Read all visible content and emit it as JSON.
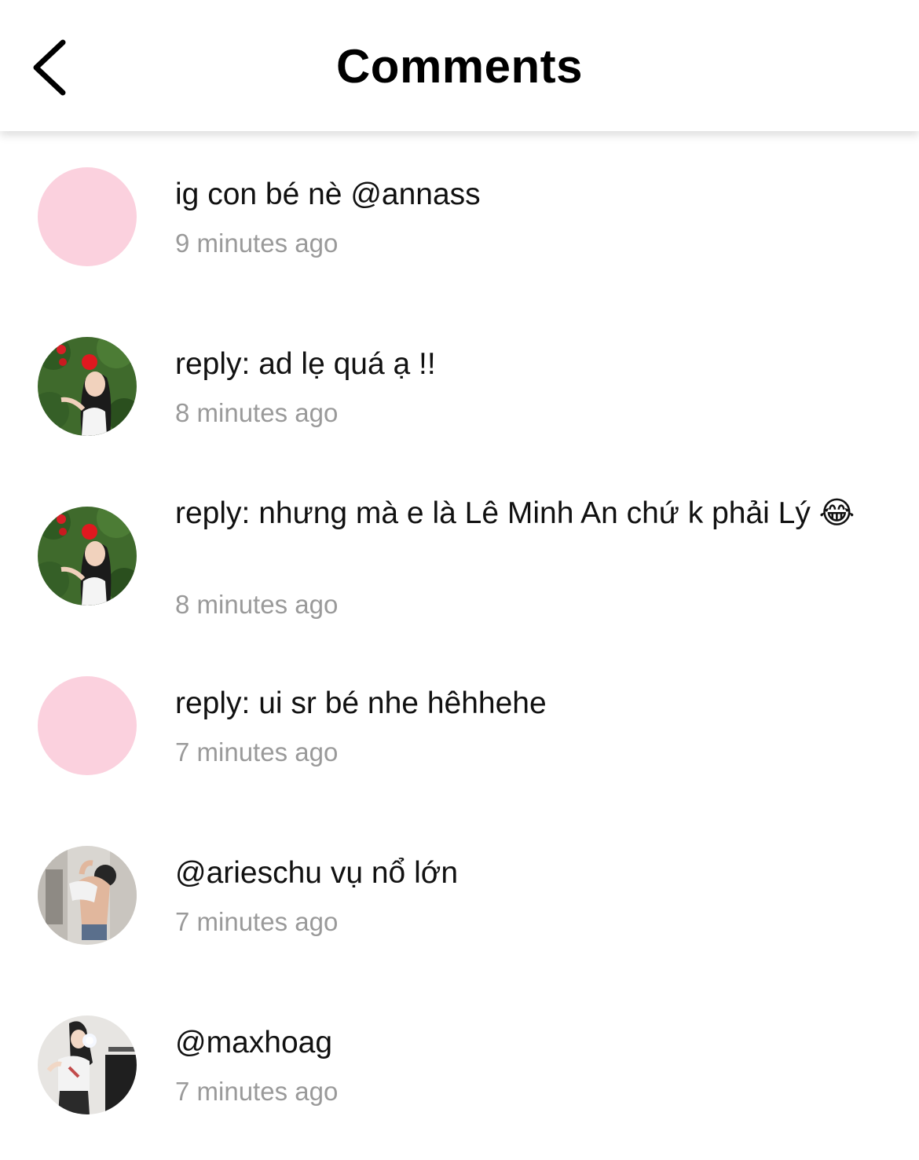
{
  "header": {
    "title": "Comments",
    "back_icon": "chevron-left-icon"
  },
  "comments": [
    {
      "avatar": "pink-placeholder",
      "text": "ig con bé nè @annass",
      "time": "9 minutes ago"
    },
    {
      "avatar": "photo-girl-flowers",
      "text": "reply: ad lẹ quá ạ !!",
      "time": "8 minutes ago"
    },
    {
      "avatar": "photo-girl-flowers",
      "text": "reply: nhưng mà e là Lê Minh An chứ k phải Lý 😂",
      "time": "8 minutes ago"
    },
    {
      "avatar": "pink-placeholder",
      "text": "reply: ui sr bé nhe hêhhehe",
      "time": "7 minutes ago"
    },
    {
      "avatar": "photo-mirror-selfie",
      "text": "@arieschu vụ nổ lớn",
      "time": "7 minutes ago"
    },
    {
      "avatar": "photo-phone-selfie",
      "text": "@maxhoag",
      "time": "7 minutes ago"
    }
  ],
  "colors": {
    "avatar_pink": "#fbd1de",
    "timestamp_gray": "#9a9a9a"
  }
}
